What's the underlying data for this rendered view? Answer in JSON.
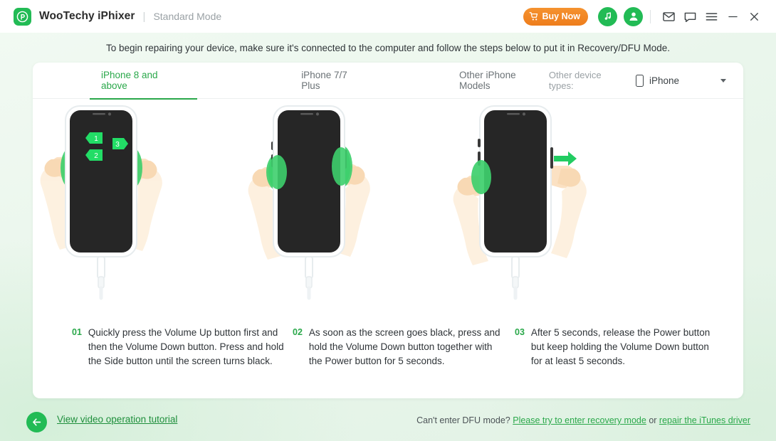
{
  "titlebar": {
    "logo_icon": "wootechy-logo-icon",
    "brand": "WooTechy iPhixer",
    "separator": "|",
    "mode": "Standard Mode",
    "buy_label": "Buy Now",
    "buy_icon": "cart-icon",
    "buy_color": "#ee7d1c",
    "music_icon": "music-search-icon",
    "account_icon": "user-account-icon",
    "mail_icon": "mail-icon",
    "feedback_icon": "chat-feedback-icon",
    "menu_icon": "hamburger-menu-icon",
    "minimize_icon": "minimize-icon",
    "close_icon": "close-icon",
    "accent_color": "#22bb55"
  },
  "banner": {
    "text": "To begin repairing your device, make sure it's connected to the computer and follow the steps below to put it in Recovery/DFU Mode."
  },
  "tabs": [
    {
      "label": "iPhone 8 and above",
      "active": true
    },
    {
      "label": "iPhone 7/7 Plus",
      "active": false
    },
    {
      "label": "Other iPhone Models",
      "active": false
    }
  ],
  "device_select": {
    "label": "Other device types:",
    "icon": "phone-icon",
    "value": "iPhone",
    "caret_icon": "chevron-down-icon"
  },
  "figures": [
    {
      "name": "iphone-step-1-illustration",
      "markers": [
        "1",
        "2",
        "3"
      ],
      "screen": "black",
      "cable": "lightning-cable"
    },
    {
      "name": "iphone-step-2-illustration",
      "markers": [],
      "screen": "black",
      "cable": "lightning-cable"
    },
    {
      "name": "iphone-step-3-illustration",
      "markers": [],
      "screen": "black",
      "cable": "lightning-cable"
    }
  ],
  "steps": [
    {
      "num": "01",
      "text": "Quickly press the Volume Up button first and then the Volume Down button. Press and hold the Side button until the screen turns black."
    },
    {
      "num": "02",
      "text": "As soon as the screen goes black, press and hold the Volume Down button together with the Power button for 5 seconds."
    },
    {
      "num": "03",
      "text": "After 5 seconds, release the Power button but keep holding the Volume Down button for at least 5 seconds."
    }
  ],
  "footer": {
    "back_icon": "back-arrow-icon",
    "tutorial_link": "View video operation tutorial",
    "dfu_question": "Can't enter DFU mode?",
    "recovery_link": "Please try to enter recovery mode",
    "or_text": "or",
    "itunes_link": "repair the iTunes driver"
  }
}
